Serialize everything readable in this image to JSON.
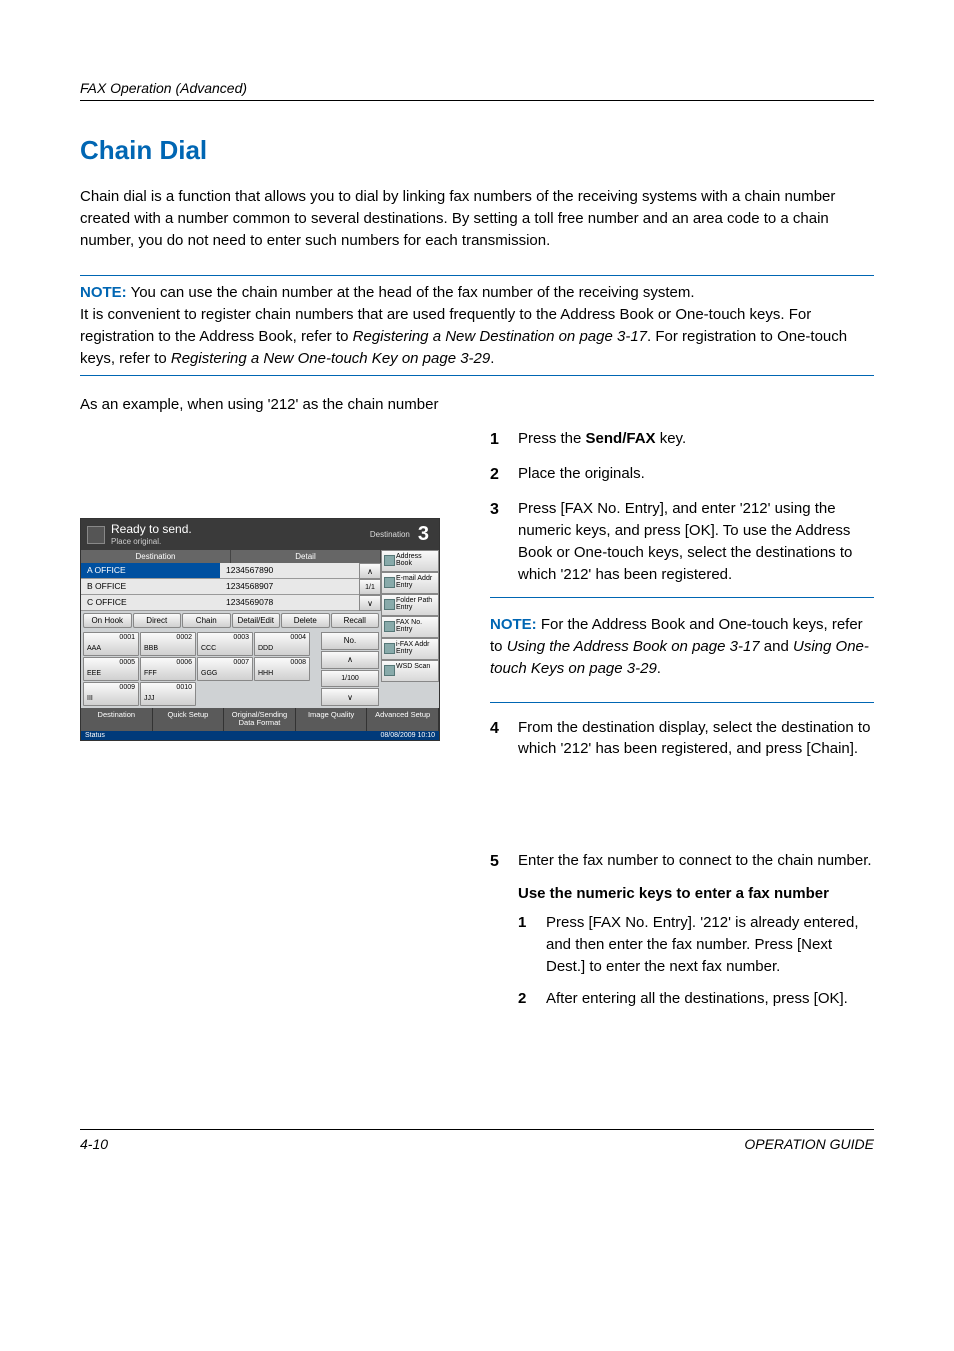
{
  "header": {
    "section": "FAX Operation (Advanced)"
  },
  "title": "Chain Dial",
  "intro": "Chain dial is a function that allows you to dial by linking fax numbers of the receiving systems with a chain number created with a number common to several destinations. By setting a toll free number and an area code to a chain number, you do not need to enter such numbers for each transmission.",
  "note1": {
    "label": "NOTE:",
    "line1": "You can use the chain number at the head of the fax number of the receiving system.",
    "line2_a": "It is convenient to register chain numbers that are used frequently to the Address Book or One-touch keys. For registration to the Address Book, refer to ",
    "ref1": "Registering a New Destination on page 3-17",
    "line2_b": ". For registration to One-touch keys, refer to ",
    "ref2": "Registering a New One-touch Key on page 3-29",
    "line2_c": "."
  },
  "example": "As an example, when using '212' as the chain number",
  "steps": {
    "s1": {
      "n": "1",
      "t_a": "Press the ",
      "bold": "Send/FAX",
      "t_b": " key."
    },
    "s2": {
      "n": "2",
      "t": "Place the originals."
    },
    "s3": {
      "n": "3",
      "t": "Press [FAX No. Entry], and enter '212' using the numeric keys, and press [OK]. To use the Address Book or One-touch keys, select the destinations to which '212' has been registered."
    },
    "s4": {
      "n": "4",
      "t": "From the destination display, select the destination to which '212' has been registered, and press [Chain]."
    },
    "s5": {
      "n": "5",
      "t": "Enter the fax number to connect to the chain number."
    }
  },
  "note2": {
    "label": "NOTE:",
    "t_a": "For the Address Book and One-touch keys, refer to ",
    "ref1": "Using the Address Book on page 3-17",
    "t_b": " and ",
    "ref2": "Using One-touch Keys on page 3-29",
    "t_c": "."
  },
  "sub": {
    "heading": "Use the numeric keys to enter a fax number",
    "s1": {
      "n": "1",
      "t": "Press [FAX No. Entry]. '212' is already entered, and then enter the fax number. Press [Next Dest.] to enter the next fax number."
    },
    "s2": {
      "n": "2",
      "t": "After entering all the destinations, press [OK]."
    }
  },
  "footer": {
    "left": "4-10",
    "right": "OPERATION GUIDE"
  },
  "panel": {
    "title_l1": "Ready to send.",
    "title_l2": "Place original.",
    "dest_label": "Destination",
    "dest_count": "3",
    "head_dest": "Destination",
    "head_detail": "Detail",
    "rows": [
      {
        "name": "A OFFICE",
        "detail": "1234567890"
      },
      {
        "name": "B OFFICE",
        "detail": "1234568907"
      },
      {
        "name": "C OFFICE",
        "detail": "1234569078"
      }
    ],
    "scroll_page": "1/1",
    "btns": [
      "On Hook",
      "Direct",
      "Chain",
      "Detail/Edit",
      "Delete",
      "Recall"
    ],
    "keys_r1": [
      {
        "num": "0001",
        "lab": "AAA"
      },
      {
        "num": "0002",
        "lab": "BBB"
      },
      {
        "num": "0003",
        "lab": "CCC"
      },
      {
        "num": "0004",
        "lab": "DDD"
      },
      {
        "num": "0005",
        "lab": "EEE"
      }
    ],
    "keys_r2": [
      {
        "num": "0006",
        "lab": "FFF"
      },
      {
        "num": "0007",
        "lab": "GGG"
      },
      {
        "num": "0008",
        "lab": "HHH"
      },
      {
        "num": "0009",
        "lab": "III"
      },
      {
        "num": "0010",
        "lab": "JJJ"
      }
    ],
    "keys_side": {
      "no": "No.",
      "page": "1/100"
    },
    "sidebar": [
      "Address Book",
      "E-mail Addr Entry",
      "Folder Path Entry",
      "FAX No. Entry",
      "i-FAX Addr Entry",
      "WSD Scan"
    ],
    "tabs": [
      "Destination",
      "Quick Setup",
      "Original/Sending Data Format",
      "Image Quality",
      "Advanced Setup"
    ],
    "status_left": "Status",
    "status_right": "08/08/2009   10:10"
  }
}
